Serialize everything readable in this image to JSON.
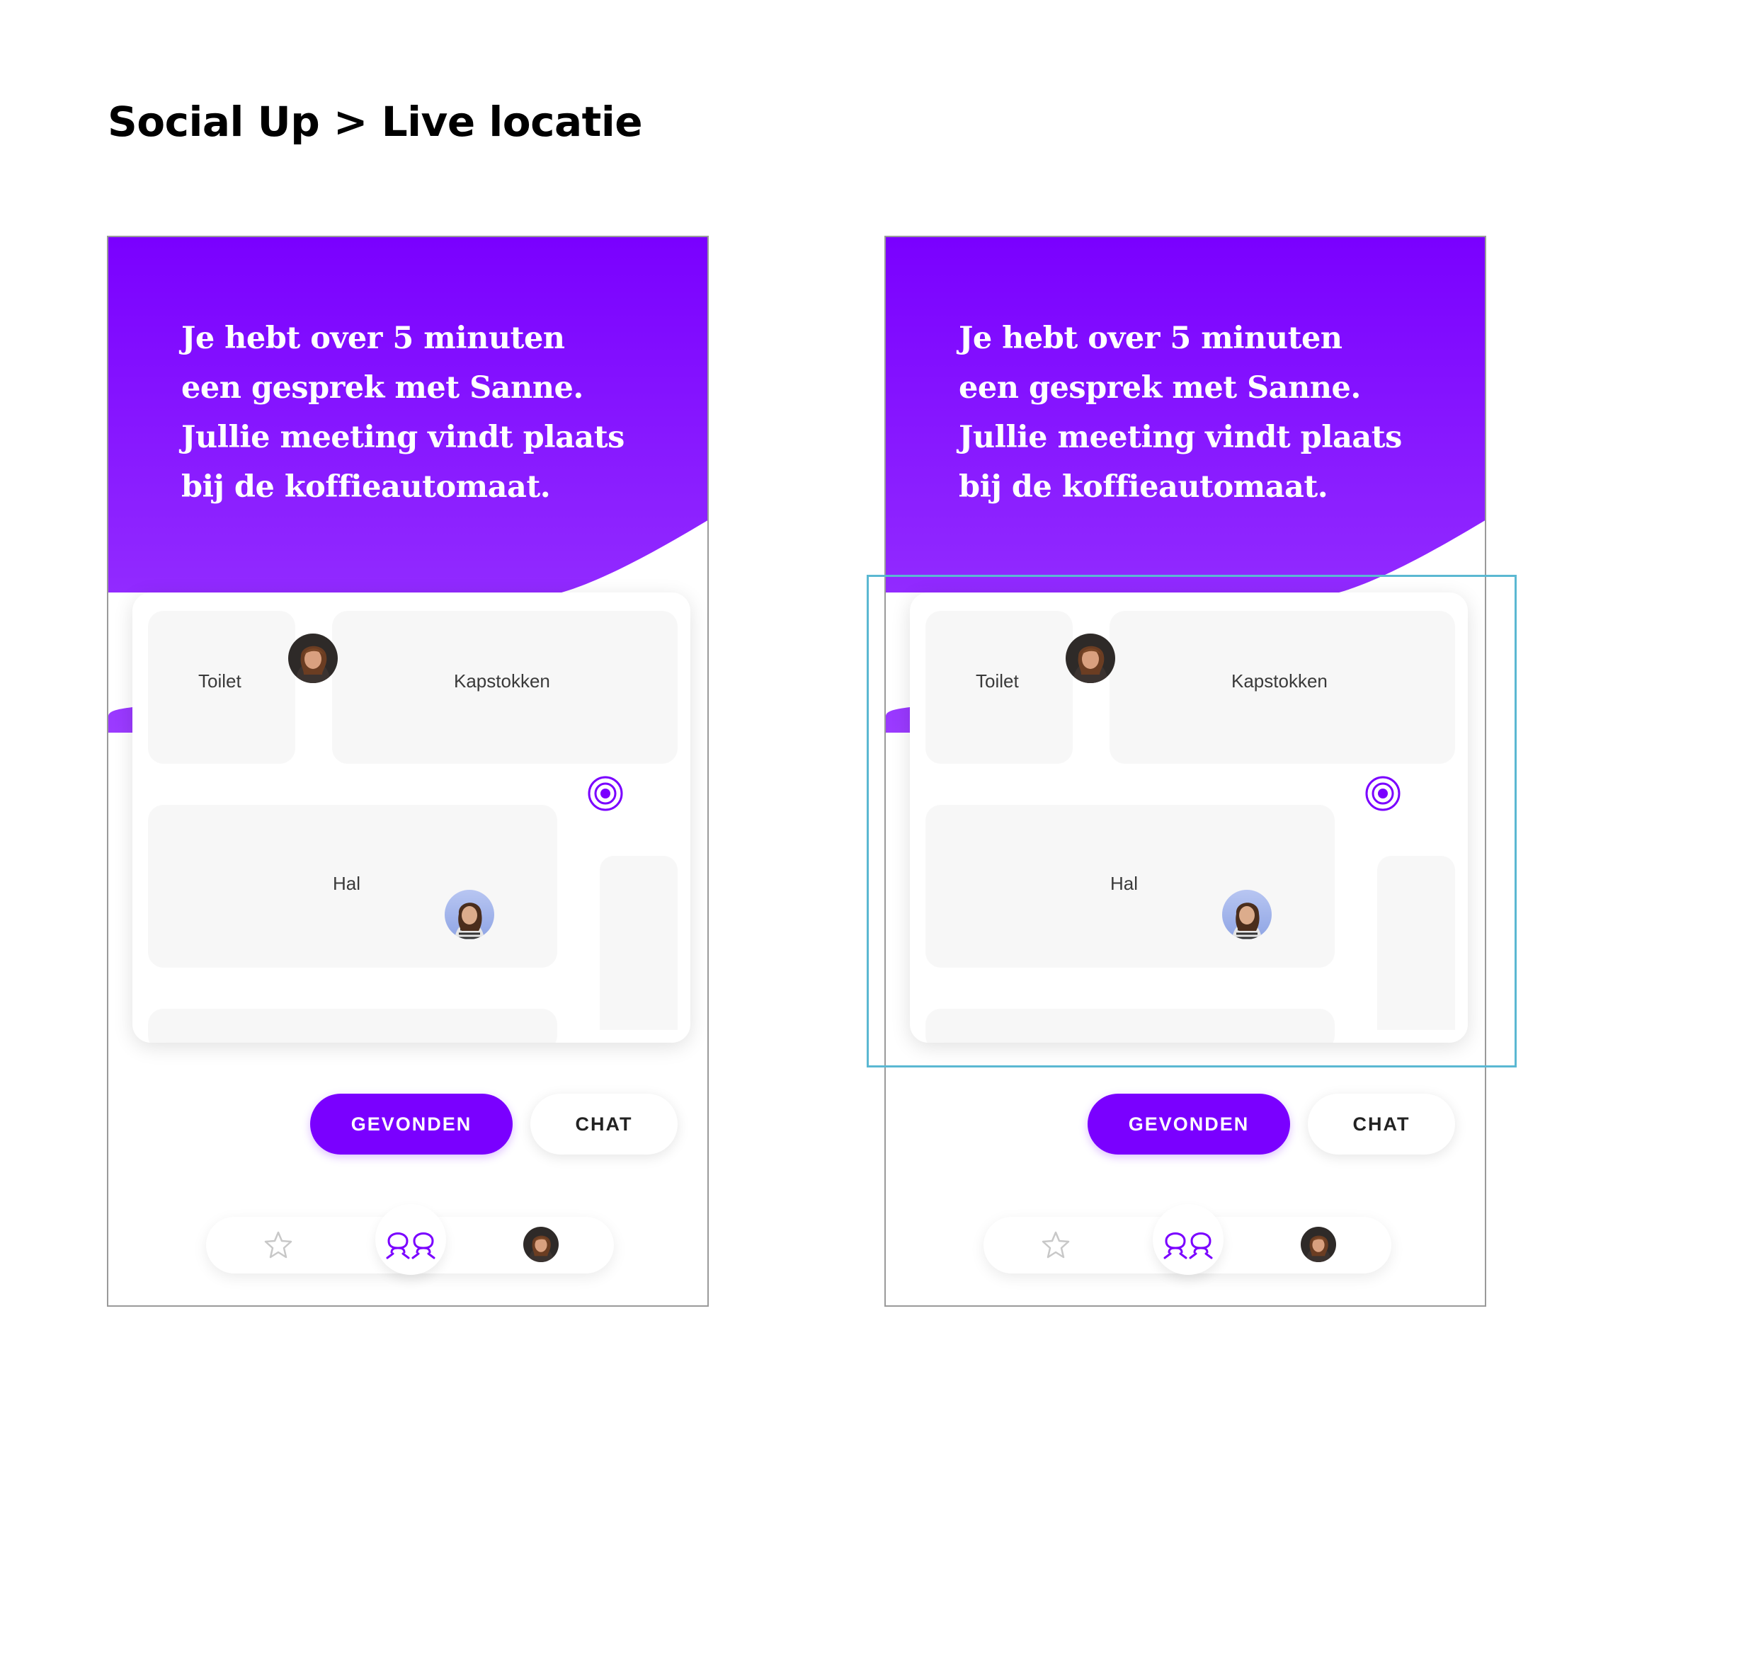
{
  "page": {
    "title": "Social Up > Live locatie"
  },
  "colors": {
    "accent": "#7a00ff",
    "hero_top": "#7a00ff",
    "hero_bottom": "#9b3bff",
    "highlight": "#5bb8d2"
  },
  "screens": [
    {
      "hero": {
        "message": "Je hebt over 5 minuten een gesprek met Sanne. Jullie meeting vindt plaats bij de koffieautomaat."
      },
      "map": {
        "rooms": {
          "toilet": "Toilet",
          "coats": "Kapstokken",
          "hall": "Hal"
        },
        "target_icon": "target-icon"
      },
      "actions": {
        "found": "GEVONDEN",
        "chat": "CHAT"
      },
      "nav": {
        "items": [
          "star-icon",
          "people-icon",
          "profile-avatar"
        ],
        "active": "people-icon"
      }
    },
    {
      "hero": {
        "message": "Je hebt over 5 minuten een gesprek met Sanne. Jullie meeting vindt plaats bij de koffieautomaat."
      },
      "map": {
        "rooms": {
          "toilet": "Toilet",
          "coats": "Kapstokken",
          "hall": "Hal"
        },
        "target_icon": "target-icon"
      },
      "actions": {
        "found": "GEVONDEN",
        "chat": "CHAT"
      },
      "nav": {
        "items": [
          "star-icon",
          "people-icon",
          "profile-avatar"
        ],
        "active": "people-icon"
      }
    }
  ]
}
